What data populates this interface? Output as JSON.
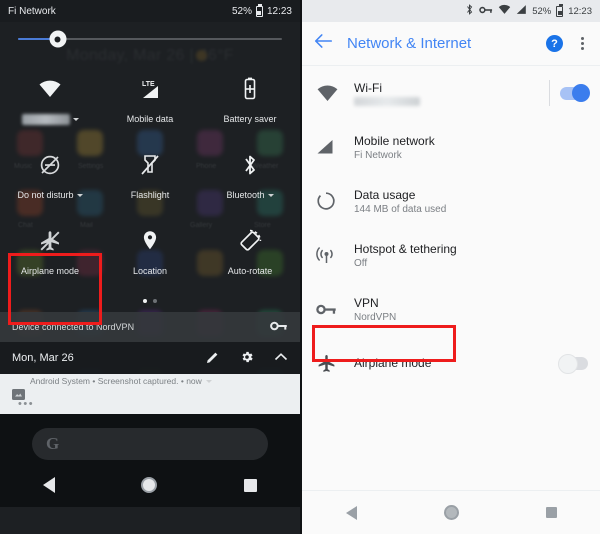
{
  "left_panel": {
    "status_bar": {
      "carrier": "Fi Network",
      "battery_percent": "52%",
      "time": "12:23",
      "battery_icon": "battery-icon"
    },
    "brightness": {
      "icon": "brightness-slider-knob-icon",
      "level_percent": 15
    },
    "wallpaper_text": {
      "date_weather": "Monday, Mar 26 | 46°F"
    },
    "tiles": [
      {
        "label": "",
        "icon": "wifi-icon",
        "redacted": true,
        "has_caret": true,
        "name": "wifi"
      },
      {
        "label": "Mobile data",
        "icon": "lte-signal-icon",
        "redacted": false,
        "has_caret": false,
        "name": "mobile-data"
      },
      {
        "label": "Battery saver",
        "icon": "battery-saver-icon",
        "redacted": false,
        "has_caret": false,
        "name": "battery-saver"
      },
      {
        "label": "Do not disturb",
        "icon": "do-not-disturb-icon",
        "redacted": false,
        "has_caret": true,
        "name": "do-not-disturb"
      },
      {
        "label": "Flashlight",
        "icon": "flashlight-off-icon",
        "redacted": false,
        "has_caret": false,
        "name": "flashlight"
      },
      {
        "label": "Bluetooth",
        "icon": "bluetooth-icon",
        "redacted": false,
        "has_caret": true,
        "name": "bluetooth"
      },
      {
        "label": "Airplane mode",
        "icon": "airplane-mode-off-icon",
        "redacted": false,
        "has_caret": false,
        "name": "airplane-mode"
      },
      {
        "label": "Location",
        "icon": "location-pin-icon",
        "redacted": false,
        "has_caret": false,
        "name": "location"
      },
      {
        "label": "Auto-rotate",
        "icon": "auto-rotate-icon",
        "redacted": false,
        "has_caret": false,
        "name": "auto-rotate"
      }
    ],
    "page_dots": {
      "total": 2,
      "active_index": 0
    },
    "vpn_notice": {
      "text": "Device connected to NordVPN",
      "icon": "vpn-key-icon"
    },
    "footer": {
      "date": "Mon, Mar 26",
      "edit_icon": "pencil-edit-icon",
      "settings_icon": "gear-icon",
      "collapse_icon": "chevron-up-icon"
    },
    "notification": {
      "header": "Android System • Screenshot captured. • now",
      "thumb_icon": "image-thumbnail-icon",
      "overflow": "•••"
    },
    "home": {
      "search_glyph": "G",
      "search_bar": "google-search-bar"
    },
    "nav": {
      "back": "back-triangle-icon",
      "home": "home-circle-icon",
      "recents": "recents-square-icon"
    },
    "highlight_color": "#ee1c1c"
  },
  "right_panel": {
    "status_bar": {
      "icons": [
        "bluetooth-icon",
        "vpn-key-icon",
        "wifi-icon",
        "signal-icon"
      ],
      "battery_percent": "52%",
      "time": "12:23"
    },
    "app_bar": {
      "back_icon": "back-arrow-icon",
      "title": "Network & Internet",
      "help_icon": "help-icon",
      "help_glyph": "?",
      "overflow_icon": "overflow-menu-icon"
    },
    "rows": [
      {
        "title": "Wi-Fi",
        "subtitle": "",
        "subtitle_redacted": true,
        "icon": "wifi-icon",
        "control": "switch",
        "switch_on": true,
        "has_divider": true
      },
      {
        "title": "Mobile network",
        "subtitle": "Fi Network",
        "subtitle_redacted": false,
        "icon": "signal-icon",
        "control": "none",
        "switch_on": false,
        "has_divider": false
      },
      {
        "title": "Data usage",
        "subtitle": "144 MB of data used",
        "subtitle_redacted": false,
        "icon": "data-usage-icon",
        "control": "none",
        "switch_on": false,
        "has_divider": false
      },
      {
        "title": "Hotspot & tethering",
        "subtitle": "Off",
        "subtitle_redacted": false,
        "icon": "hotspot-icon",
        "control": "none",
        "switch_on": false,
        "has_divider": false
      },
      {
        "title": "VPN",
        "subtitle": "NordVPN",
        "subtitle_redacted": false,
        "icon": "vpn-key-icon",
        "control": "none",
        "switch_on": false,
        "has_divider": false
      },
      {
        "title": "Airplane mode",
        "subtitle": "",
        "subtitle_redacted": false,
        "icon": "airplane-icon",
        "control": "switch",
        "switch_on": false,
        "has_divider": false
      }
    ],
    "nav": {
      "back": "back-triangle-icon",
      "home": "home-circle-icon",
      "recents": "recents-square-icon"
    },
    "highlight_color": "#ee1c1c"
  }
}
